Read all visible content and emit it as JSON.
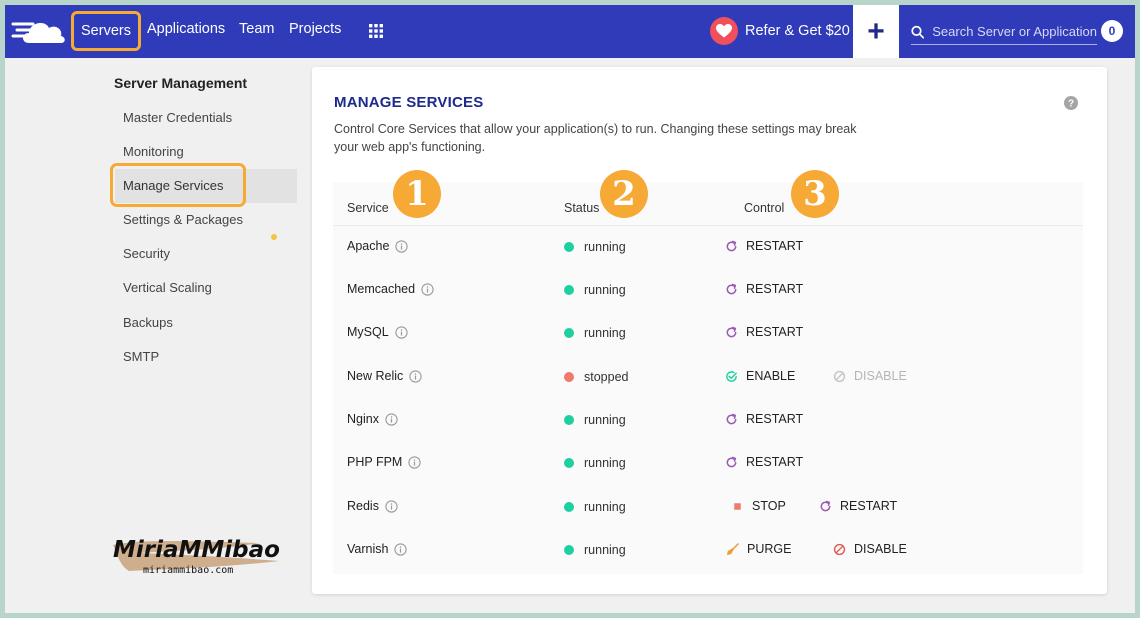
{
  "nav": {
    "servers": "Servers",
    "applications": "Applications",
    "team": "Team",
    "projects": "Projects",
    "refer": "Refer & Get $20",
    "plus": "+",
    "search_placeholder": "Search Server or Application",
    "count": "0"
  },
  "sidebar": {
    "title": "Server Management",
    "items": [
      {
        "label": "Master Credentials"
      },
      {
        "label": "Monitoring"
      },
      {
        "label": "Manage Services",
        "active": true
      },
      {
        "label": "Settings & Packages"
      },
      {
        "label": "Security"
      },
      {
        "label": "Vertical Scaling"
      },
      {
        "label": "Backups"
      },
      {
        "label": "SMTP"
      }
    ]
  },
  "watermark": {
    "title": "MiriaMMibao",
    "url": "miriammibao.com"
  },
  "main": {
    "title": "MANAGE SERVICES",
    "description": "Control Core Services that allow your application(s) to run. Changing these settings may break your web app's functioning.",
    "columns": {
      "service": "Service",
      "status": "Status",
      "control": "Control"
    },
    "badges": [
      "1",
      "2",
      "3"
    ],
    "rows": [
      {
        "service": "Apache",
        "status": "running",
        "controls": [
          {
            "label": "RESTART",
            "icon": "restart-icon"
          }
        ]
      },
      {
        "service": "Memcached",
        "status": "running",
        "controls": [
          {
            "label": "RESTART",
            "icon": "restart-icon"
          }
        ]
      },
      {
        "service": "MySQL",
        "status": "running",
        "controls": [
          {
            "label": "RESTART",
            "icon": "restart-icon"
          }
        ]
      },
      {
        "service": "New Relic",
        "status": "stopped",
        "controls": [
          {
            "label": "ENABLE",
            "icon": "check-circle-icon"
          },
          {
            "label": "DISABLE",
            "icon": "ban-icon",
            "disabled": true
          }
        ]
      },
      {
        "service": "Nginx",
        "status": "running",
        "controls": [
          {
            "label": "RESTART",
            "icon": "restart-icon"
          }
        ]
      },
      {
        "service": "PHP FPM",
        "status": "running",
        "controls": [
          {
            "label": "RESTART",
            "icon": "restart-icon"
          }
        ]
      },
      {
        "service": "Redis",
        "status": "running",
        "controls": [
          {
            "label": "STOP",
            "icon": "stop-icon"
          },
          {
            "label": "RESTART",
            "icon": "restart-icon"
          }
        ]
      },
      {
        "service": "Varnish",
        "status": "running",
        "controls": [
          {
            "label": "PURGE",
            "icon": "broom-icon"
          },
          {
            "label": "DISABLE",
            "icon": "ban-icon"
          }
        ]
      }
    ]
  },
  "colors": {
    "topbar": "#2f3bb8",
    "highlight": "#f6a935",
    "running": "#1ecfa0",
    "stopped": "#f07b6c",
    "title": "#1d2a8c"
  }
}
